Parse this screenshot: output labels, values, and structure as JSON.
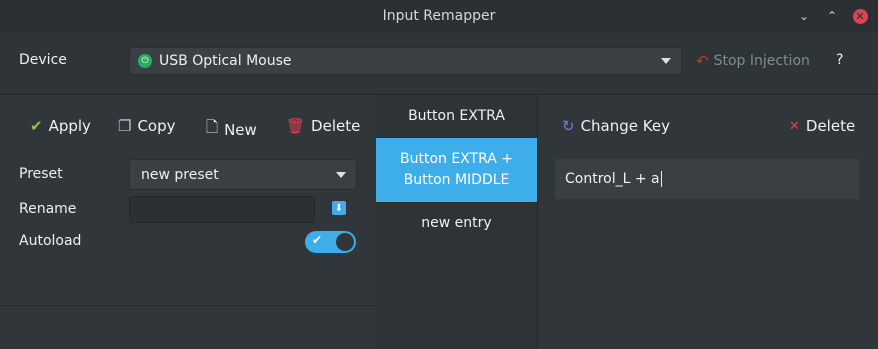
{
  "window": {
    "title": "Input Remapper"
  },
  "device": {
    "label": "Device",
    "selected": "USB Optical Mouse",
    "stop_injection": "Stop Injection",
    "help": "?"
  },
  "preset_toolbar": {
    "apply": "Apply",
    "copy": "Copy",
    "new": "New",
    "delete": "Delete"
  },
  "preset": {
    "label": "Preset",
    "selected": "new preset",
    "rename_label": "Rename",
    "rename_value": "",
    "autoload_label": "Autoload",
    "autoload_on": true
  },
  "mappings": [
    {
      "line1": "Button EXTRA",
      "line2": ""
    },
    {
      "line1": "Button EXTRA +",
      "line2": "Button MIDDLE"
    },
    {
      "line1": "new entry",
      "line2": ""
    }
  ],
  "editor": {
    "change_key": "Change Key",
    "delete": "Delete",
    "value": "Control_L + a"
  },
  "colors": {
    "accent": "#3daee9",
    "danger": "#da4453",
    "ok": "#27ae60"
  }
}
